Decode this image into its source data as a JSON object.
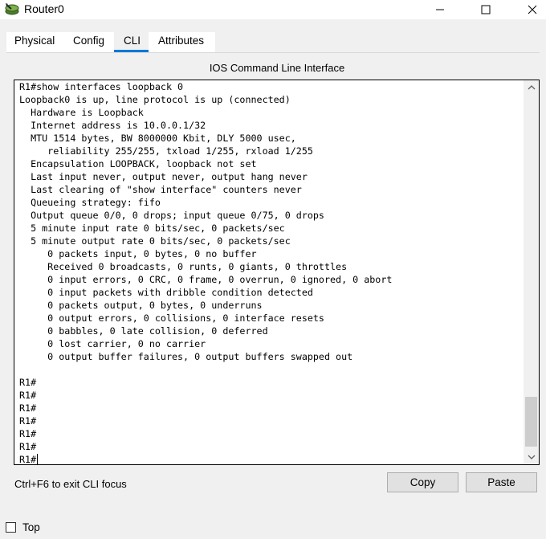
{
  "window": {
    "title": "Router0",
    "icon": "router-icon"
  },
  "tabs": [
    {
      "label": "Physical",
      "active": false
    },
    {
      "label": "Config",
      "active": false
    },
    {
      "label": "CLI",
      "active": true
    },
    {
      "label": "Attributes",
      "active": false
    }
  ],
  "panel": {
    "title": "IOS Command Line Interface"
  },
  "terminal": {
    "lines": [
      "R1#show interfaces loopback 0",
      "Loopback0 is up, line protocol is up (connected)",
      "  Hardware is Loopback",
      "  Internet address is 10.0.0.1/32",
      "  MTU 1514 bytes, BW 8000000 Kbit, DLY 5000 usec,",
      "     reliability 255/255, txload 1/255, rxload 1/255",
      "  Encapsulation LOOPBACK, loopback not set",
      "  Last input never, output never, output hang never",
      "  Last clearing of \"show interface\" counters never",
      "  Queueing strategy: fifo",
      "  Output queue 0/0, 0 drops; input queue 0/75, 0 drops",
      "  5 minute input rate 0 bits/sec, 0 packets/sec",
      "  5 minute output rate 0 bits/sec, 0 packets/sec",
      "     0 packets input, 0 bytes, 0 no buffer",
      "     Received 0 broadcasts, 0 runts, 0 giants, 0 throttles",
      "     0 input errors, 0 CRC, 0 frame, 0 overrun, 0 ignored, 0 abort",
      "     0 input packets with dribble condition detected",
      "     0 packets output, 0 bytes, 0 underruns",
      "     0 output errors, 0 collisions, 0 interface resets",
      "     0 babbles, 0 late collision, 0 deferred",
      "     0 lost carrier, 0 no carrier",
      "     0 output buffer failures, 0 output buffers swapped out",
      "",
      "R1#",
      "R1#",
      "R1#",
      "R1#",
      "R1#",
      "R1#",
      "R1#"
    ]
  },
  "footer": {
    "hint": "Ctrl+F6 to exit CLI focus",
    "copy_label": "Copy",
    "paste_label": "Paste"
  },
  "bottom": {
    "top_label": "Top",
    "top_checked": false
  }
}
